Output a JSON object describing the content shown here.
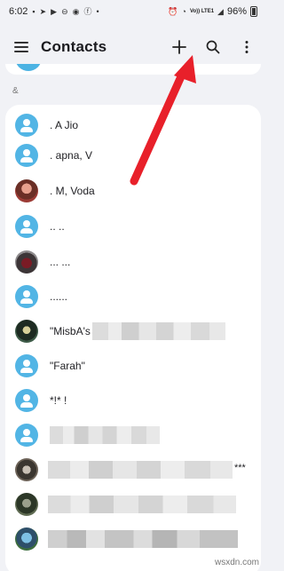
{
  "status_bar": {
    "time": "6:02",
    "network_label": "Vo)) LTE1",
    "battery": "96%",
    "battery_level": 0.96
  },
  "app_bar": {
    "title": "Contacts"
  },
  "section": {
    "letter": "&"
  },
  "contacts": [
    {
      "name": ". A Jio",
      "avatar": "default"
    },
    {
      "name": ". apna, V",
      "avatar": "default"
    },
    {
      "name": ". M, Voda",
      "avatar": "photo"
    },
    {
      "name": ".. ..",
      "avatar": "default"
    },
    {
      "name": "... ...",
      "avatar": "photo"
    },
    {
      "name": "......",
      "avatar": "default"
    },
    {
      "name": "\"MisbA's",
      "avatar": "photo",
      "redacted": true
    },
    {
      "name": "\"Farah\"",
      "avatar": "default"
    },
    {
      "name": "*!* !",
      "avatar": "default"
    },
    {
      "name": "",
      "avatar": "default",
      "redacted": true
    },
    {
      "name": "",
      "avatar": "photo",
      "redacted": true,
      "suffix": "***"
    },
    {
      "name": "",
      "avatar": "photo",
      "redacted": true
    },
    {
      "name": "",
      "avatar": "photo",
      "redacted": true
    }
  ],
  "annotation": {
    "arrow_color": "#e8202a"
  },
  "watermark": "wsxdn.com"
}
